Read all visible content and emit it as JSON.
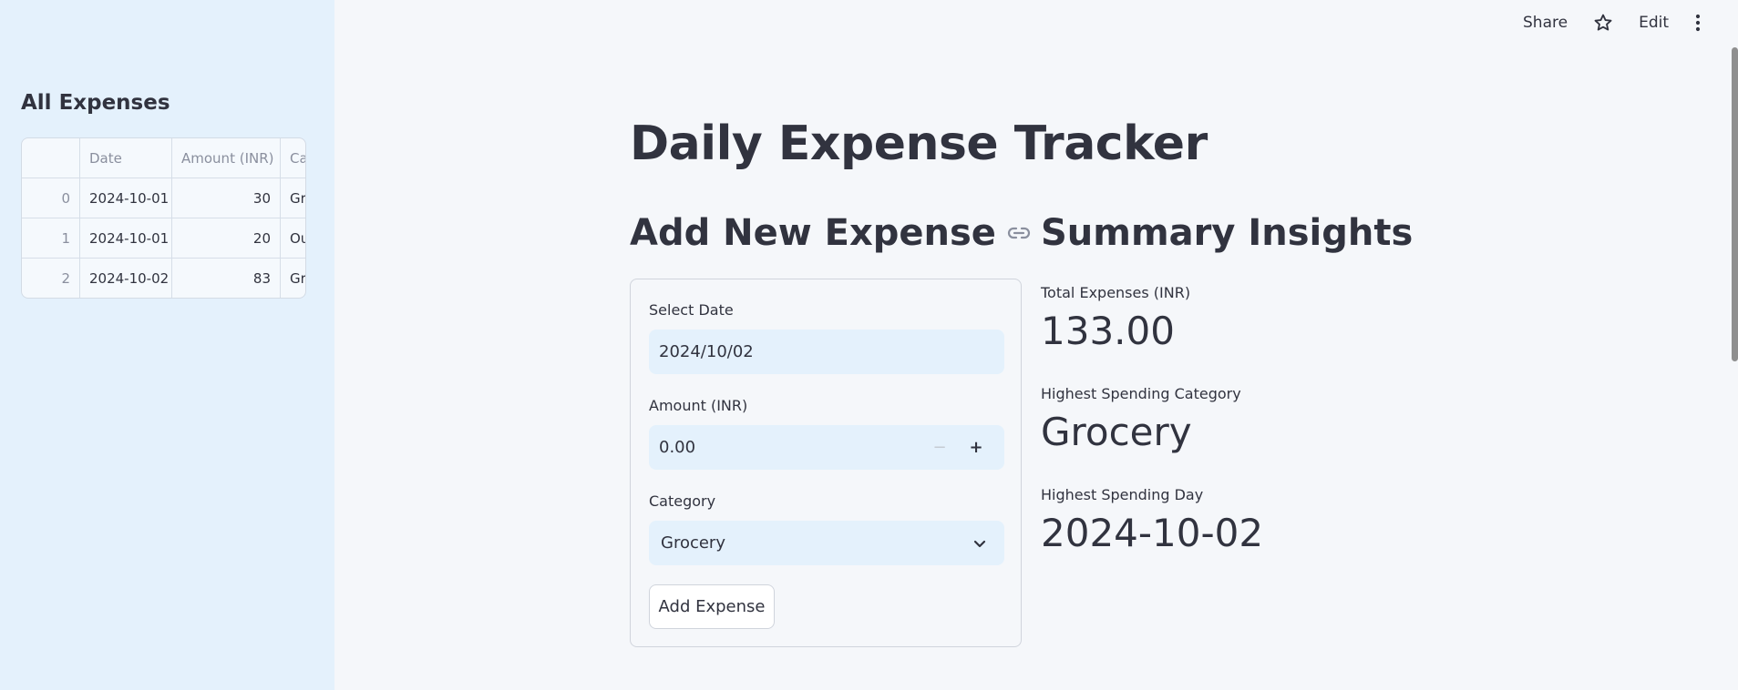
{
  "toolbar": {
    "share": "Share",
    "edit": "Edit"
  },
  "sidebar": {
    "title": "All Expenses",
    "table": {
      "headers": [
        "",
        "Date",
        "Amount (INR)",
        "Category"
      ],
      "rows": [
        [
          "0",
          "2024-10-01",
          "30",
          "Grocery"
        ],
        [
          "1",
          "2024-10-01",
          "20",
          "Outing"
        ],
        [
          "2",
          "2024-10-02",
          "83",
          "Grocery"
        ]
      ]
    }
  },
  "main": {
    "title": "Daily Expense Tracker",
    "add_section": {
      "title": "Add New Expense",
      "date_label": "Select Date",
      "date_value": "2024/10/02",
      "amount_label": "Amount (INR)",
      "amount_value": "0.00",
      "category_label": "Category",
      "category_value": "Grocery",
      "button": "Add Expense"
    },
    "summary": {
      "title": "Summary Insights",
      "total_label": "Total Expenses (INR)",
      "total_value": "133.00",
      "category_label": "Highest Spending Category",
      "category_value": "Grocery",
      "day_label": "Highest Spending Day",
      "day_value": "2024-10-02"
    }
  },
  "icons": [
    "link-icon",
    "star-icon",
    "kebab-menu-icon",
    "minus-icon",
    "plus-icon",
    "chevron-down-icon"
  ]
}
